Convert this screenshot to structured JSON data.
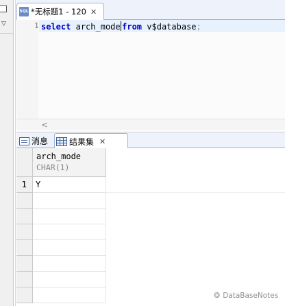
{
  "editor_tab": {
    "title": "*无标题1 - 120",
    "icon_label": "SQL",
    "close_glyph": "✕"
  },
  "editor": {
    "line_number": "1",
    "code": {
      "kw_select": "select",
      "ident_col": "arch_mode",
      "kw_from": "from",
      "ident_table": "v$database",
      "semi": ";"
    }
  },
  "scrollbar": {
    "left_arrow": "<"
  },
  "result_tabs": [
    {
      "label": "消息",
      "icon": "message-icon"
    },
    {
      "label": "结果集",
      "icon": "grid-icon",
      "close_glyph": "✕"
    }
  ],
  "result_grid": {
    "columns": [
      {
        "name": "arch_mode",
        "type": "CHAR(1)"
      }
    ],
    "rows": [
      {
        "row_number": "1",
        "cells": [
          "Y"
        ]
      }
    ]
  },
  "watermark": {
    "text": "DataBaseNotes",
    "icon": "wechat-icon"
  },
  "colors": {
    "keyword": "#0000c0",
    "current_line": "#e8f2fe",
    "tab_border": "#9fb3d1",
    "header_bg": "#f3f3f3"
  }
}
